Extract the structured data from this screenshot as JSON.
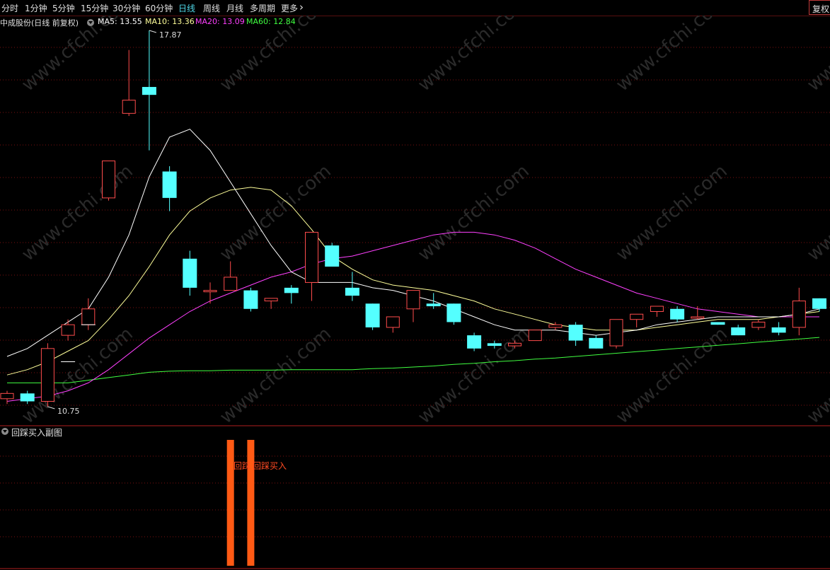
{
  "toolbar": {
    "tabs": [
      "分时",
      "1分钟",
      "5分钟",
      "15分钟",
      "30分钟",
      "60分钟",
      "日线",
      "周线",
      "月线",
      "多周期",
      "更多"
    ],
    "active_tab": "日线",
    "right_button": "复权"
  },
  "main_panel": {
    "stock_label": "中成股份(日线 前复权)",
    "ma5": "MA5: 13.55",
    "ma10": "MA10: 13.36",
    "ma20": "MA20: 13.09",
    "ma60": "MA60: 12.84",
    "high_note": "17.87",
    "low_note": "10.75",
    "watermark": "www.cfchi.com"
  },
  "sub_panel": {
    "title": "回踩买入副图",
    "signal_label_1": "回踩",
    "signal_label_2": "回踩买入"
  },
  "colors": {
    "background": "#000000",
    "up_candle": "#ff4c4c",
    "down_candle": "#54ffff",
    "ma5": "#ffffff",
    "ma10": "#ffff9a",
    "ma20": "#ff40ff",
    "ma60": "#40ff40",
    "signal_bar": "#ff5a14",
    "grid": "#7a1010"
  },
  "chart_data": {
    "type": "candlestick",
    "price_axis_visible": false,
    "candles_ohlc": [
      [
        10.9,
        11.05,
        10.8,
        11.0
      ],
      [
        11.0,
        11.05,
        10.8,
        10.85
      ],
      [
        10.85,
        11.95,
        10.75,
        11.85
      ],
      [
        12.1,
        12.4,
        12.0,
        12.3
      ],
      [
        12.3,
        12.8,
        12.2,
        12.6
      ],
      [
        14.7,
        15.4,
        14.65,
        15.4
      ],
      [
        16.3,
        17.5,
        16.25,
        16.55
      ],
      [
        16.8,
        17.87,
        15.6,
        16.65
      ],
      [
        15.2,
        15.3,
        14.45,
        14.7
      ],
      [
        13.55,
        13.7,
        12.85,
        13.0
      ],
      [
        12.95,
        13.1,
        12.7,
        12.95
      ],
      [
        12.95,
        13.5,
        12.95,
        13.2
      ],
      [
        12.95,
        13.0,
        12.55,
        12.6
      ],
      [
        12.75,
        12.8,
        12.6,
        12.8
      ],
      [
        13.0,
        13.05,
        12.7,
        12.9
      ],
      [
        13.1,
        14.05,
        12.75,
        14.05
      ],
      [
        13.8,
        13.85,
        13.4,
        13.4
      ],
      [
        13.0,
        13.3,
        12.75,
        12.85
      ],
      [
        12.7,
        12.7,
        12.2,
        12.25
      ],
      [
        12.25,
        12.45,
        12.15,
        12.45
      ],
      [
        12.6,
        12.9,
        12.35,
        12.95
      ],
      [
        12.7,
        12.9,
        12.6,
        12.65
      ],
      [
        12.7,
        12.7,
        12.3,
        12.35
      ],
      [
        12.1,
        12.15,
        11.8,
        11.85
      ],
      [
        11.95,
        12.0,
        11.85,
        11.9
      ],
      [
        11.9,
        12.0,
        11.85,
        11.95
      ],
      [
        12.0,
        12.2,
        12.0,
        12.2
      ],
      [
        12.25,
        12.35,
        12.2,
        12.3
      ],
      [
        12.3,
        12.35,
        11.9,
        12.0
      ],
      [
        12.05,
        12.1,
        11.85,
        11.85
      ],
      [
        11.9,
        12.4,
        11.85,
        12.4
      ],
      [
        12.4,
        12.5,
        12.25,
        12.5
      ],
      [
        12.55,
        12.65,
        12.45,
        12.65
      ],
      [
        12.6,
        12.65,
        12.35,
        12.4
      ],
      [
        12.45,
        12.65,
        12.4,
        12.45
      ],
      [
        12.35,
        12.35,
        12.3,
        12.3
      ],
      [
        12.25,
        12.3,
        12.1,
        12.1
      ],
      [
        12.25,
        12.4,
        12.2,
        12.35
      ],
      [
        12.25,
        12.35,
        12.1,
        12.15
      ],
      [
        12.25,
        13.0,
        12.1,
        12.75
      ],
      [
        12.8,
        12.8,
        12.55,
        12.6
      ]
    ],
    "ma5": [
      11.7,
      11.85,
      12.1,
      12.35,
      12.6,
      13.2,
      14.0,
      15.1,
      15.85,
      16.0,
      15.6,
      15.0,
      14.4,
      13.8,
      13.3,
      13.1,
      13.1,
      13.1,
      13.0,
      12.95,
      12.85,
      12.75,
      12.6,
      12.45,
      12.3,
      12.2,
      12.2,
      12.2,
      12.15,
      12.1,
      12.15,
      12.2,
      12.3,
      12.35,
      12.4,
      12.45,
      12.45,
      12.45,
      12.45,
      12.5,
      12.6
    ],
    "ma10": [
      11.35,
      11.45,
      11.6,
      11.8,
      12.0,
      12.4,
      12.85,
      13.4,
      14.0,
      14.45,
      14.7,
      14.85,
      14.9,
      14.85,
      14.55,
      14.1,
      13.6,
      13.35,
      13.15,
      13.05,
      13.0,
      12.95,
      12.85,
      12.75,
      12.6,
      12.5,
      12.4,
      12.3,
      12.25,
      12.2,
      12.2,
      12.2,
      12.25,
      12.3,
      12.35,
      12.4,
      12.4,
      12.4,
      12.45,
      12.5,
      12.55
    ],
    "ma20": [
      10.85,
      10.9,
      10.95,
      11.05,
      11.2,
      11.45,
      11.75,
      12.05,
      12.3,
      12.55,
      12.75,
      12.9,
      13.05,
      13.2,
      13.3,
      13.45,
      13.55,
      13.6,
      13.7,
      13.8,
      13.9,
      14.0,
      14.05,
      14.05,
      14.0,
      13.9,
      13.75,
      13.55,
      13.35,
      13.2,
      13.05,
      12.9,
      12.8,
      12.7,
      12.6,
      12.55,
      12.5,
      12.45,
      12.45,
      12.45,
      12.45
    ],
    "ma60": [
      11.2,
      11.2,
      11.2,
      11.2,
      11.25,
      11.3,
      11.35,
      11.4,
      11.42,
      11.43,
      11.43,
      11.44,
      11.44,
      11.44,
      11.45,
      11.45,
      11.45,
      11.45,
      11.47,
      11.48,
      11.5,
      11.52,
      11.55,
      11.57,
      11.6,
      11.62,
      11.65,
      11.67,
      11.7,
      11.73,
      11.76,
      11.79,
      11.82,
      11.85,
      11.88,
      11.91,
      11.94,
      11.97,
      12.0,
      12.03,
      12.06
    ],
    "extra_marks": [
      [
        4,
        12.3
      ],
      [
        3,
        11.6
      ]
    ],
    "signal_bars": [
      11,
      12
    ]
  }
}
